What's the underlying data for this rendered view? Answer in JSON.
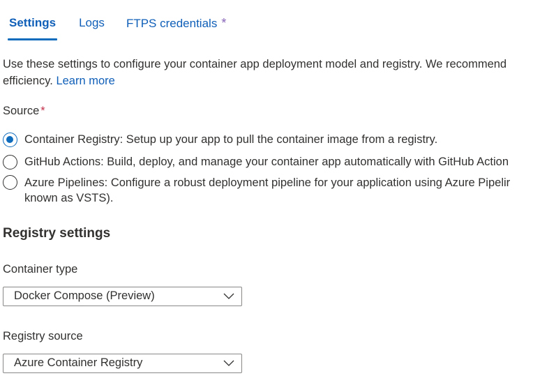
{
  "tabs": [
    {
      "label": "Settings",
      "active": true
    },
    {
      "label": "Logs",
      "active": false
    },
    {
      "label": "FTPS credentials",
      "active": false,
      "modified_marker": "*"
    }
  ],
  "intro": {
    "line1": "Use these settings to configure your container app deployment model and registry. We recommend",
    "line2_prefix": "efficiency.",
    "learn_more": "Learn more"
  },
  "source": {
    "label": "Source",
    "required_marker": "*",
    "options": [
      {
        "text": "Container Registry: Setup up your app to pull the container image from a registry.",
        "selected": true
      },
      {
        "text": "GitHub Actions: Build, deploy, and manage your container app automatically with GitHub Action",
        "selected": false
      },
      {
        "text": "Azure Pipelines: Configure a robust deployment pipeline for your application using Azure Pipelir",
        "text_line2": "known as VSTS).",
        "selected": false
      }
    ]
  },
  "registry_settings": {
    "title": "Registry settings",
    "container_type": {
      "label": "Container type",
      "value": "Docker Compose (Preview)"
    },
    "registry_source": {
      "label": "Registry source",
      "value": "Azure Container Registry"
    }
  },
  "icons": {
    "dropdown": "chevron-down-icon"
  },
  "colors": {
    "accent": "#0f6cbd",
    "link": "#0f5fb8",
    "required": "#c4314b",
    "modified": "#8764b8",
    "text": "#323130"
  }
}
